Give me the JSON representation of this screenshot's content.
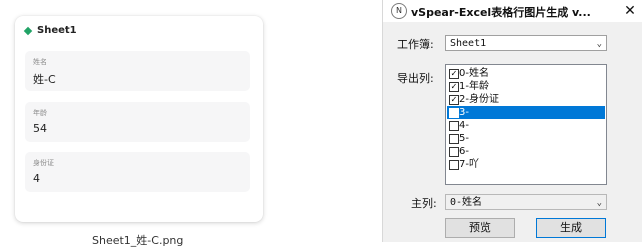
{
  "preview": {
    "card_title": "Sheet1",
    "fields": [
      {
        "label": "姓名",
        "value": "姓-C"
      },
      {
        "label": "年龄",
        "value": "54"
      },
      {
        "label": "身份证",
        "value": "4"
      }
    ],
    "filename": "Sheet1_姓-C.png",
    "accent_color": "#21a366"
  },
  "dialog": {
    "app_icon_letter": "N",
    "title": "vSpear-Excel表格行图片生成 v...",
    "close_glyph": "✕",
    "workbook_label": "工作簿:",
    "workbook_value": "Sheet1",
    "columns_label": "导出列:",
    "columns": [
      {
        "label": "0-姓名",
        "checked": true,
        "selected": false
      },
      {
        "label": "1-年龄",
        "checked": true,
        "selected": false
      },
      {
        "label": "2-身份证",
        "checked": true,
        "selected": false
      },
      {
        "label": "3-",
        "checked": false,
        "selected": true
      },
      {
        "label": "4-",
        "checked": false,
        "selected": false
      },
      {
        "label": "5-",
        "checked": false,
        "selected": false
      },
      {
        "label": "6-",
        "checked": false,
        "selected": false
      },
      {
        "label": "7-吖",
        "checked": false,
        "selected": false
      }
    ],
    "key_column_label": "主列:",
    "key_column_value": "0-姓名",
    "preview_button": "预览",
    "generate_button": "生成",
    "selection_color": "#0078d7"
  }
}
